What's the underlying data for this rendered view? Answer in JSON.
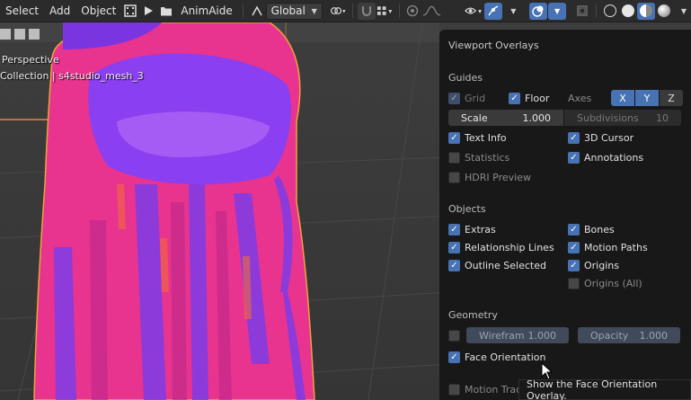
{
  "header": {
    "menus": [
      "Select",
      "Add",
      "Object"
    ],
    "animaide_label": "AnimAide",
    "transform_orientation": "Global"
  },
  "viewport": {
    "view_name": "Perspective",
    "collection_info": "Collection | s4studio_mesh_3"
  },
  "overlays": {
    "title": "Viewport Overlays",
    "guides": {
      "heading": "Guides",
      "grid_label": "Grid",
      "floor_label": "Floor",
      "axes_label": "Axes",
      "axes": [
        "X",
        "Y",
        "Z"
      ],
      "scale_label": "Scale",
      "scale_value": "1.000",
      "subdivisions_label": "Subdivisions",
      "subdivisions_value": "10",
      "text_info_label": "Text Info",
      "cursor_label": "3D Cursor",
      "statistics_label": "Statistics",
      "annotations_label": "Annotations",
      "hdri_label": "HDRI Preview"
    },
    "objects": {
      "heading": "Objects",
      "extras_label": "Extras",
      "bones_label": "Bones",
      "relationship_label": "Relationship Lines",
      "motion_paths_label": "Motion Paths",
      "outline_label": "Outline Selected",
      "origins_label": "Origins",
      "origins_all_label": "Origins (All)"
    },
    "geometry": {
      "heading": "Geometry",
      "wireframe_label": "Wirefram",
      "wireframe_value": "1.000",
      "opacity_label": "Opacity",
      "opacity_value": "1.000",
      "face_orientation_label": "Face Orientation",
      "motion_tracking_label": "Motion Trac"
    },
    "tooltip": "Show the Face Orientation Overlay."
  },
  "colors": {
    "accent": "#4772b3",
    "panel_bg": "#181818",
    "face_front": "#e8338f",
    "face_back": "#8a3ff0"
  }
}
